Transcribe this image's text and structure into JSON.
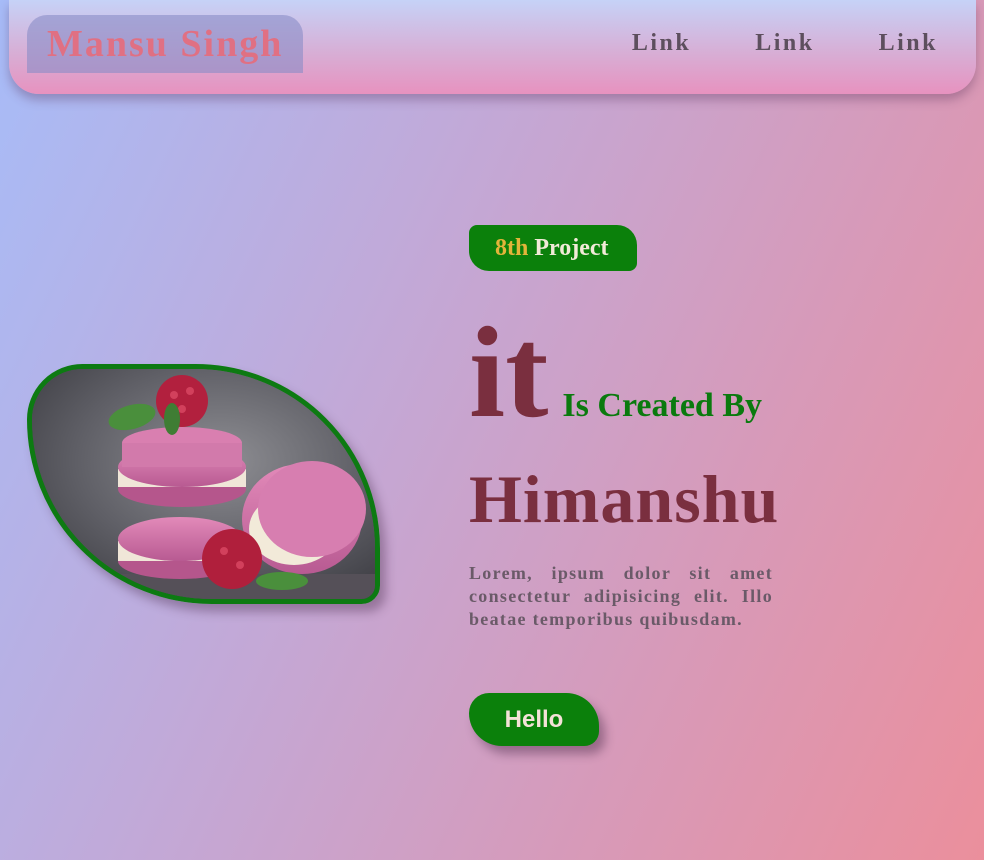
{
  "header": {
    "logo": "Mansu Singh",
    "nav_links": [
      "Link",
      "Link",
      "Link"
    ]
  },
  "hero": {
    "badge_number": "8th",
    "badge_word": "Project",
    "big_word": "it",
    "created_by": "Is Created By",
    "name": "Himanshu",
    "paragraph": "Lorem, ipsum dolor sit amet consectetur adipisicing elit. Illo beatae temporibus quibusdam.",
    "button_label": "Hello"
  },
  "colors": {
    "accent_green": "#0b800b",
    "maroon": "#7a2f3f",
    "logo_pink": "#e07083",
    "badge_gold": "#e2b43a"
  }
}
